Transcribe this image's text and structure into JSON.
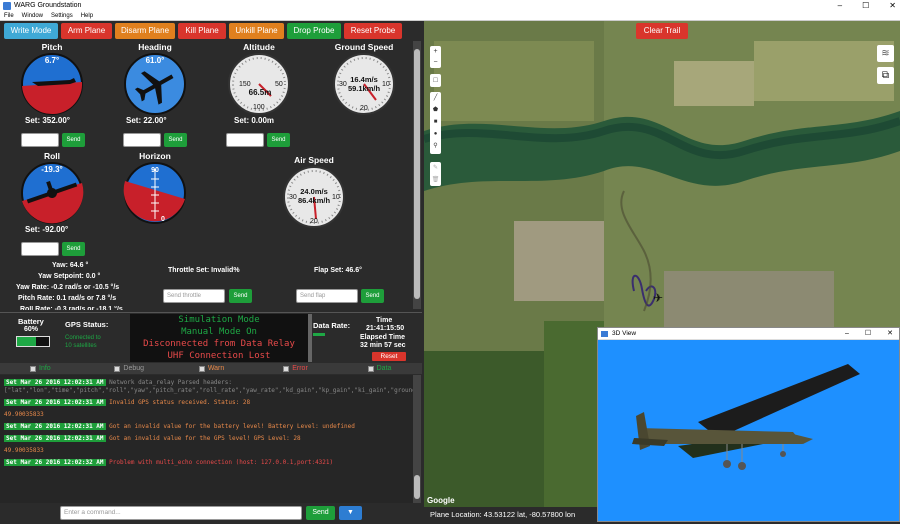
{
  "window": {
    "title": "WARG Groundstation",
    "controls": [
      "–",
      "☐",
      "✕"
    ]
  },
  "menu": [
    "File",
    "Window",
    "Settings",
    "Help"
  ],
  "toolbar": [
    {
      "label": "Write Mode",
      "color": "#3fa9d6"
    },
    {
      "label": "Arm Plane",
      "color": "#d9352c"
    },
    {
      "label": "Disarm Plane",
      "color": "#e0801e"
    },
    {
      "label": "Kill Plane",
      "color": "#d9352c"
    },
    {
      "label": "Unkill Plane",
      "color": "#e0801e"
    },
    {
      "label": "Drop Probe",
      "color": "#1e9e3a"
    },
    {
      "label": "Reset Probe",
      "color": "#d9352c"
    }
  ],
  "gauges": {
    "pitch": {
      "title": "Pitch",
      "value": "6.7°",
      "set": "Set: 352.00°"
    },
    "heading": {
      "title": "Heading",
      "value": "61.0°",
      "set": "Set: 22.00°"
    },
    "altitude": {
      "title": "Altitude",
      "value": "66.5m",
      "ticks": [
        "150",
        "50",
        "100"
      ],
      "set": "Set: 0.00m"
    },
    "ground_speed": {
      "title": "Ground Speed",
      "value1": "16.4m/s",
      "value2": "59.1km/h",
      "ticks": [
        "30",
        "10",
        "20"
      ]
    },
    "roll": {
      "title": "Roll",
      "value": "-19.3°",
      "set": "Set: -92.00°"
    },
    "horizon": {
      "title": "Horizon",
      "ticks": [
        "90",
        "0"
      ]
    },
    "air_speed": {
      "title": "Air Speed",
      "value1": "24.0m/s",
      "value2": "86.4km/h",
      "ticks": [
        "30",
        "10",
        "20"
      ]
    }
  },
  "send_label": "Send",
  "telemetry": {
    "yaw": "Yaw: 64.6 °",
    "yaw_setpoint": "Yaw Setpoint: 0.0 °",
    "yaw_rate": "Yaw Rate: -0.2 rad/s or -10.5 °/s",
    "pitch_rate": "Pitch Rate: 0.1 rad/s or 7.8 °/s",
    "roll_rate": "Roll Rate: -0.3 rad/s or -18.1 °/s",
    "throttle": "Throttle Set: Invalid%",
    "flap": "Flap Set: 46.6°",
    "throttle_placeholder": "Send throttle",
    "flap_placeholder": "Send flap"
  },
  "status": {
    "battery_label": "Battery",
    "battery_pct": "60%",
    "battery_level": 0.6,
    "gps_label": "GPS Status:",
    "gps_value1": "Connected to",
    "gps_value2": "10 satellites",
    "sim_mode": "Simulation Mode",
    "manual_mode": "Manual Mode On",
    "relay": "Disconnected from Data Relay",
    "uhf": "UHF Connection Lost",
    "data_rate_label": "Data Rate:",
    "time_label": "Time",
    "time_value": "21:41:15:50",
    "elapsed_label": "Elapsed Time",
    "elapsed_value": "32 min 57 sec",
    "reset_label": "Reset"
  },
  "log_tabs": [
    "Info",
    "Debug",
    "Warn",
    "Error",
    "Data"
  ],
  "log": [
    {
      "ts": "Set Mar 26 2016 12:02:31 AM",
      "msg": "Network data_relay Parsed headers: [\"lat\",\"lon\",\"time\",\"pitch\",\"roll\",\"yaw\",\"pitch_rate\",\"roll_rate\",\"yaw_rate\",\"kd_gain\",\"kp_gain\",\"ki_gain\",\"ground_speed\",\"altitude\",\"heading\",\"pitch_setpoint\",\"roll_setpoint\",\"heading_setpoint\",\"throttle_setpoint\",\"altitude_setpoint\",\"int_pitch_setpoint\",\"int_roll_setpoint\",\"int_yaw_setpoint\",\"lastCommandSent\",\"errorCodes\",\"cameraStatus\",\"waypointIndex\",\"editing_gain\",\"gpsStatus\"]",
      "color": "#888"
    },
    {
      "ts": "Set Mar 26 2016 12:02:31 AM",
      "msg": "Invalid GPS status received. Status: 28",
      "color": "#e8894a"
    },
    {
      "ts": "",
      "msg": "49.90035833",
      "color": "#e8894a"
    },
    {
      "ts": "Set Mar 26 2016 12:02:31 AM",
      "msg": "Got an invalid value for the battery level! Battery Level: undefined",
      "color": "#e8894a"
    },
    {
      "ts": "Set Mar 26 2016 12:02:31 AM",
      "msg": "Got an invalid value for the GPS level! GPS Level: 28",
      "color": "#e8894a"
    },
    {
      "ts": "",
      "msg": "49.90035833",
      "color": "#e8894a"
    },
    {
      "ts": "Set Mar 26 2016 12:02:32 AM",
      "msg": "Problem with multi_echo connection (host: 127.0.0.1,port:4321)",
      "color": "#e84a4a"
    }
  ],
  "command": {
    "placeholder": "Enter a command...",
    "send": "Send",
    "dropdown": "▼"
  },
  "map": {
    "clear_trail": "Clear Trail",
    "google": "Google",
    "location": "Plane Location: 43.53122 lat, -80.57800 lon"
  },
  "view3d": {
    "title": "3D View"
  }
}
